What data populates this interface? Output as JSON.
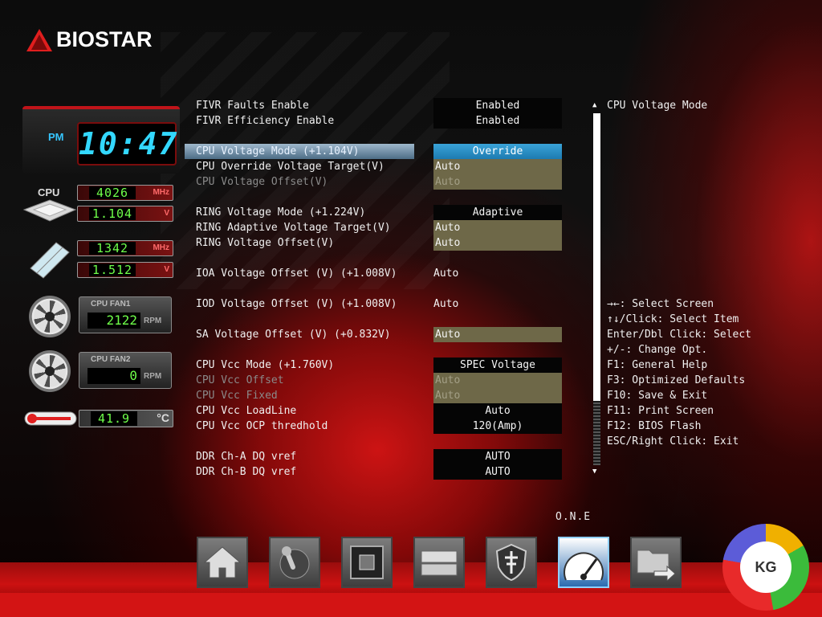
{
  "brand": {
    "logo_text": "BIOSTAR"
  },
  "clock": {
    "ampm": "PM",
    "time": "10:47"
  },
  "monitor": {
    "cpu_label": "CPU",
    "cpu_freq": "4026",
    "cpu_freq_unit": "MHz",
    "cpu_volt": "1.104",
    "cpu_volt_unit": "V",
    "mem_freq": "1342",
    "mem_freq_unit": "MHz",
    "mem_volt": "1.512",
    "mem_volt_unit": "V",
    "fan1_label": "CPU FAN1",
    "fan1_value": "2122",
    "fan1_unit": "RPM",
    "fan2_label": "CPU FAN2",
    "fan2_value": "0",
    "fan2_unit": "RPM",
    "temp_value": "41.9",
    "temp_unit": "°C"
  },
  "settings": [
    {
      "label": "FIVR Faults Enable",
      "value": "Enabled"
    },
    {
      "label": "FIVR Efficiency Enable",
      "value": "Enabled"
    },
    {
      "label": "CPU Voltage Mode (+1.104V)",
      "value": "Override"
    },
    {
      "label": "CPU Override Voltage Target(V)",
      "value": "Auto"
    },
    {
      "label": "CPU Voltage Offset(V)",
      "value": "Auto"
    },
    {
      "label": "RING Voltage Mode (+1.224V)",
      "value": "Adaptive"
    },
    {
      "label": "RING Adaptive Voltage Target(V)",
      "value": "Auto"
    },
    {
      "label": "RING Voltage Offset(V)",
      "value": "Auto"
    },
    {
      "label": "IOA Voltage Offset (V) (+1.008V)",
      "value": "Auto"
    },
    {
      "label": "IOD Voltage Offset (V) (+1.008V)",
      "value": "Auto"
    },
    {
      "label": "SA Voltage Offset (V) (+0.832V)",
      "value": "Auto"
    },
    {
      "label": "CPU Vcc Mode (+1.760V)",
      "value": "SPEC Voltage"
    },
    {
      "label": "CPU Vcc Offset",
      "value": "Auto"
    },
    {
      "label": "CPU Vcc Fixed",
      "value": "Auto"
    },
    {
      "label": "CPU Vcc LoadLine",
      "value": "Auto"
    },
    {
      "label": "CPU Vcc OCP thredhold",
      "value": "120(Amp)"
    },
    {
      "label": "DDR Ch-A DQ vref",
      "value": "AUTO"
    },
    {
      "label": "DDR Ch-B DQ vref",
      "value": "AUTO"
    }
  ],
  "help": {
    "title": "CPU Voltage Mode",
    "keys": [
      "→←: Select Screen",
      "↑↓/Click: Select Item",
      "Enter/Dbl Click: Select",
      "+/-: Change Opt.",
      "F1: General Help",
      "F3: Optimized Defaults",
      "F10: Save & Exit",
      "F11: Print Screen",
      "F12: BIOS Flash",
      "ESC/Right Click: Exit"
    ]
  },
  "nav": {
    "active_label": "O.N.E",
    "icons": [
      "home-icon",
      "joystick-icon",
      "chip-icon",
      "drive-icon",
      "shield-cross-icon",
      "speedometer-icon",
      "folder-exit-icon"
    ]
  },
  "watermark": {
    "text": "KG"
  },
  "colors": {
    "accent_red": "#d31414",
    "selected_blue": "#2a8fc8",
    "lcd_green": "#6fff4a",
    "clock_cyan": "#33d8ff"
  }
}
